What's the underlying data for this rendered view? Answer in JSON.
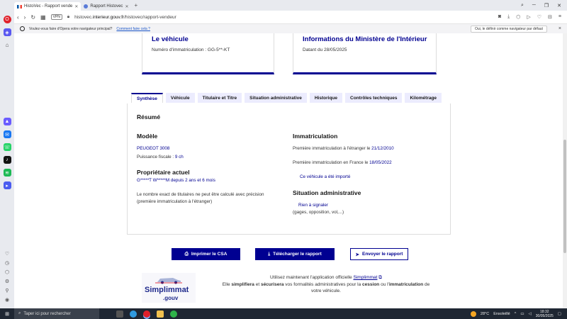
{
  "browser": {
    "tabs": [
      {
        "label": "HistoVec - Rapport vende",
        "active": true
      },
      {
        "label": "Rapport Histovec",
        "active": false
      }
    ],
    "new_tab": "+",
    "security_badge": "VPN",
    "url_prefix": "histovec.",
    "url_domain": "interieur.gouv.fr",
    "url_path": "/histovec/rapport-vendeur"
  },
  "infobar": {
    "question": "Voulez-vous faire d'Opera votre navigateur principal?",
    "link": "Comment faire cela ?",
    "button": "Oui, le définir comme navigateur par défaut",
    "close": "×"
  },
  "cards": {
    "vehicle": {
      "title": "Le véhicule",
      "text": "Numéro d'immatriculation : GG-5**-KT"
    },
    "ministry": {
      "title": "Informations du Ministère de l'Intérieur",
      "text": "Datant du 28/05/2025"
    }
  },
  "tabs": [
    {
      "label": "Synthèse",
      "active": true
    },
    {
      "label": "Véhicule",
      "active": false
    },
    {
      "label": "Titulaire et Titre",
      "active": false
    },
    {
      "label": "Situation administrative",
      "active": false
    },
    {
      "label": "Historique",
      "active": false
    },
    {
      "label": "Contrôles techniques",
      "active": false
    },
    {
      "label": "Kilométrage",
      "active": false
    }
  ],
  "summary": {
    "title": "Résumé",
    "model_heading": "Modèle",
    "model_value": "PEUGEOT 3008",
    "power_label": "Puissance fiscale :",
    "power_value": "9 ch",
    "owner_heading": "Propriétaire actuel",
    "owner_name": "G*****T W*****M",
    "owner_since_label": "depuis",
    "owner_since": "2 ans et 6 mois",
    "owner_note_1": "Le nombre exact de titulaires ne peut être calculé avec précision",
    "owner_note_2": "(première immatriculation à l'étranger)",
    "immat_heading": "Immatriculation",
    "first_abroad_label": "Première immatriculation à l'étranger le",
    "first_abroad_date": "21/12/2010",
    "first_france_label": "Première immatriculation en France le",
    "first_france_date": "18/05/2022",
    "imported": "Ce véhicule a été importé",
    "admin_heading": "Situation administrative",
    "admin_status": "Rien à signaler",
    "admin_note": "(gages, opposition, vol,...)"
  },
  "actions": {
    "print": "Imprimer le CSA",
    "download": "Télécharger le rapport",
    "send": "Envoyer le rapport"
  },
  "promo": {
    "logo_text": "Simplimmat",
    "logo_suffix": ".gouv",
    "line1_pre": "Utilisez maintenant l'application officielle",
    "line1_link": "Simplimmat",
    "line2_pre": "Elle",
    "bold1": "simplifiera",
    "and": "et",
    "bold2": "sécurisera",
    "line2_mid": "vos formalités administratives pour la",
    "bold3": "cession",
    "or": "ou l'",
    "bold4": "immatriculation",
    "line2_end": "de",
    "line3": "votre véhicule."
  },
  "taskbar": {
    "search_placeholder": "Taper ici pour rechercher",
    "temperature": "28°C",
    "weather": "Ensoleillé",
    "time": "18:32",
    "date": "30/05/2025"
  }
}
